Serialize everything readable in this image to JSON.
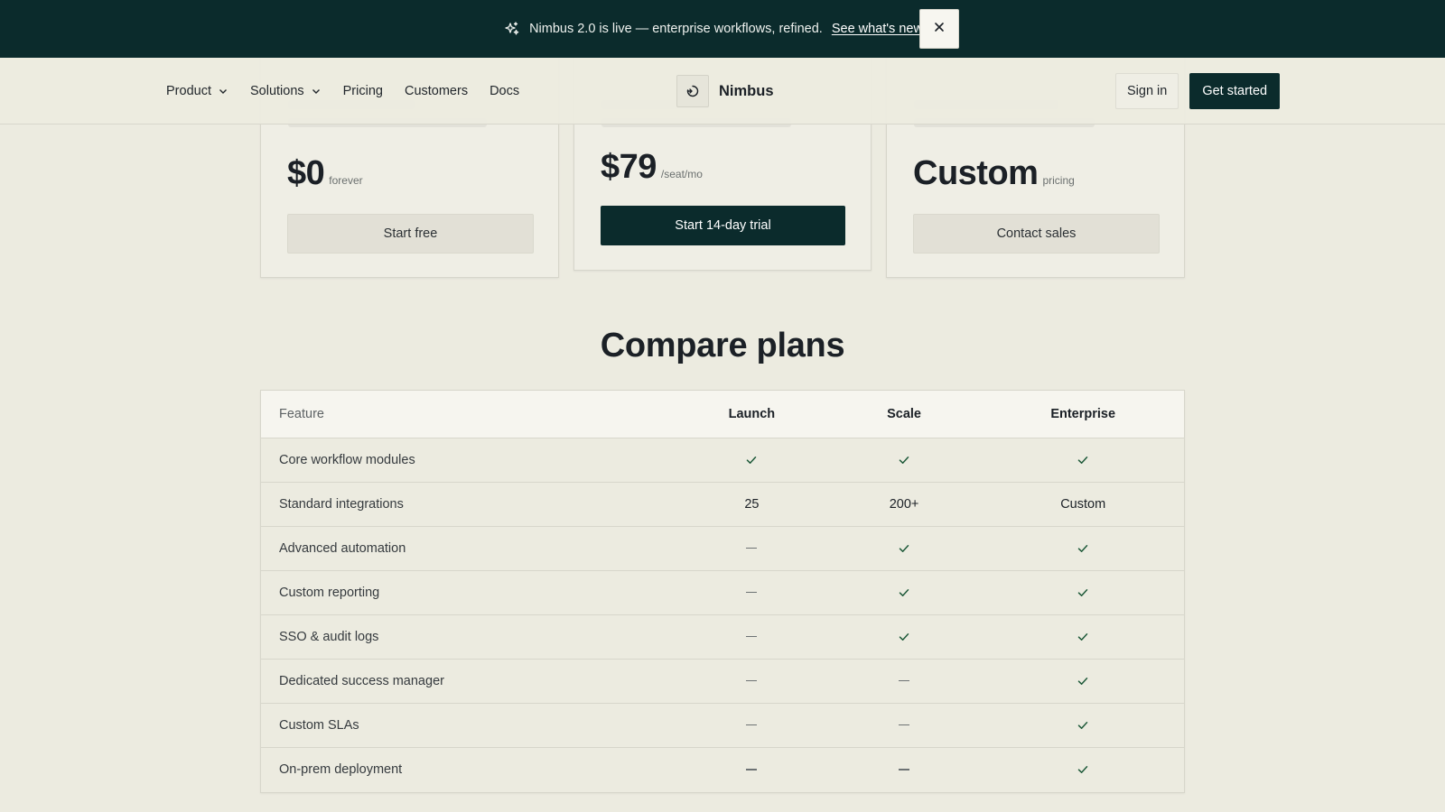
{
  "announcement": {
    "text": "Nimbus 2.0 is live — enterprise workflows, refined.",
    "link": "See what's new",
    "icon": "sparkle-icon",
    "close_icon": "close-icon"
  },
  "nav": {
    "items": [
      {
        "label": "Product",
        "has_dropdown": true
      },
      {
        "label": "Solutions",
        "has_dropdown": true
      },
      {
        "label": "Pricing",
        "has_dropdown": false
      },
      {
        "label": "Customers",
        "has_dropdown": false
      },
      {
        "label": "Docs",
        "has_dropdown": false
      }
    ],
    "brand": {
      "name": "Nimbus",
      "icon": "nimbus-logo-icon"
    },
    "sign_in": "Sign in",
    "get_started": "Get started"
  },
  "plans": [
    {
      "price": "$0",
      "unit": "forever",
      "cta": "Start free",
      "cta_style": "muted"
    },
    {
      "price": "$79",
      "unit": "/seat/mo",
      "cta": "Start 14-day trial",
      "cta_style": "dark"
    },
    {
      "price": "Custom",
      "unit": "pricing",
      "cta": "Contact sales",
      "cta_style": "muted"
    }
  ],
  "compare": {
    "title": "Compare plans",
    "headers": {
      "feature": "Feature",
      "launch": "Launch",
      "scale": "Scale",
      "enterprise": "Enterprise"
    },
    "rows": [
      {
        "feature": "Core workflow modules",
        "launch": "check",
        "scale": "check",
        "enterprise": "check"
      },
      {
        "feature": "Standard integrations",
        "launch": "25",
        "scale": "200+",
        "enterprise": "Custom"
      },
      {
        "feature": "Advanced automation",
        "launch": "dash",
        "scale": "check",
        "enterprise": "check"
      },
      {
        "feature": "Custom reporting",
        "launch": "dash",
        "scale": "check",
        "enterprise": "check"
      },
      {
        "feature": "SSO & audit logs",
        "launch": "dash",
        "scale": "check",
        "enterprise": "check"
      },
      {
        "feature": "Dedicated success manager",
        "launch": "dash",
        "scale": "dash",
        "enterprise": "check"
      },
      {
        "feature": "Custom SLAs",
        "launch": "dash",
        "scale": "dash",
        "enterprise": "check"
      },
      {
        "feature": "On-prem deployment",
        "launch": "dash",
        "scale": "dash",
        "enterprise": "check"
      }
    ]
  },
  "colors": {
    "brand_dark": "#0b2b2c",
    "page_bg": "#ecebe0",
    "check_green": "#1f5a3a"
  }
}
